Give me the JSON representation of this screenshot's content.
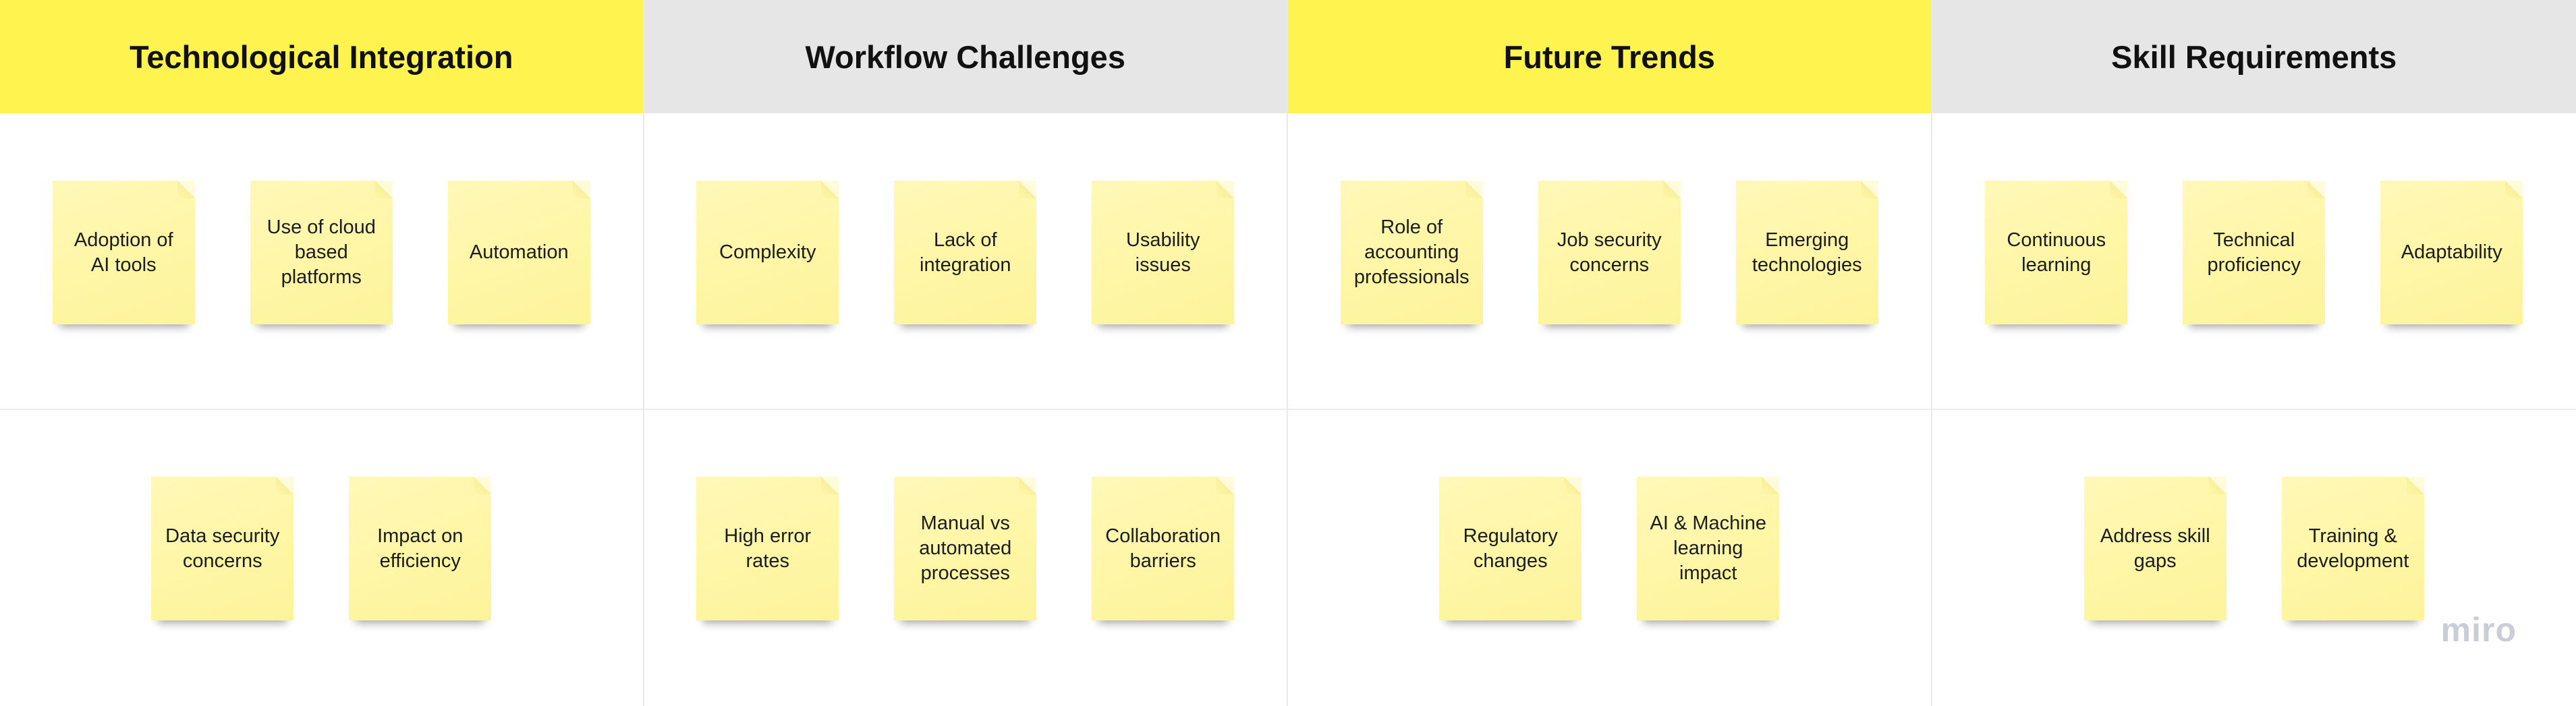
{
  "columns": [
    {
      "title": "Technological Integration",
      "header_color": "#fff44f",
      "top": [
        "Adoption of AI tools",
        "Use of cloud based platforms",
        "Automation"
      ],
      "bottom": [
        "Data security concerns",
        "Impact on efficiency"
      ]
    },
    {
      "title": "Workflow Challenges",
      "header_color": "#e6e6e6",
      "top": [
        "Complexity",
        "Lack of integration",
        "Usability issues"
      ],
      "bottom": [
        "High error rates",
        "Manual vs automated processes",
        "Collaboration barriers"
      ]
    },
    {
      "title": "Future Trends",
      "header_color": "#fff44f",
      "top": [
        "Role of accounting professionals",
        "Job security concerns",
        "Emerging technologies"
      ],
      "bottom": [
        "Regulatory changes",
        "AI & Machine learning impact"
      ]
    },
    {
      "title": "Skill Requirements",
      "header_color": "#e6e6e6",
      "top": [
        "Continuous learning",
        "Technical proficiency",
        "Adaptability"
      ],
      "bottom": [
        "Address skill gaps",
        "Training & development"
      ]
    }
  ],
  "logo": "miro"
}
